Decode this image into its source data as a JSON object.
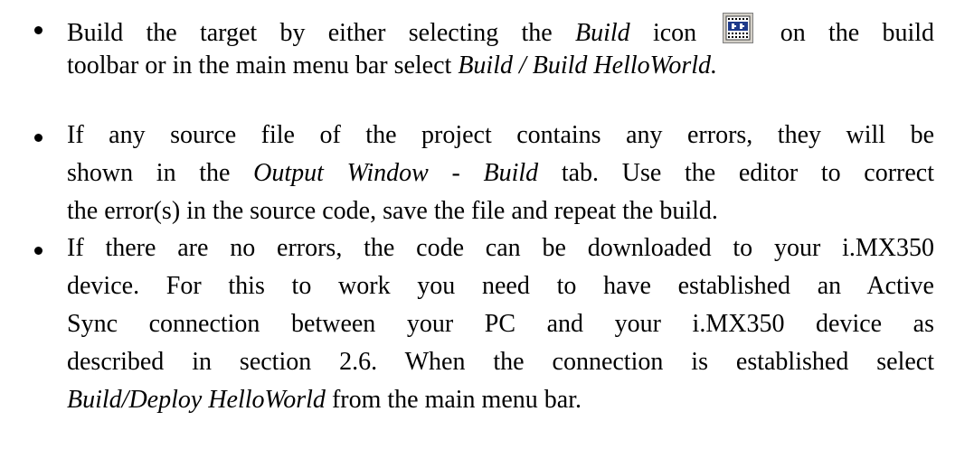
{
  "bullets": [
    {
      "lines": [
        {
          "parts": [
            {
              "text": "Build the target by either selecting the ",
              "italic": false
            },
            {
              "text": "Build",
              "italic": true
            },
            {
              "text": " icon ",
              "italic": false
            },
            {
              "icon": "build-icon"
            },
            {
              "text": " on the build",
              "italic": false
            }
          ]
        },
        {
          "parts": [
            {
              "text": "toolbar or in the main menu bar select ",
              "italic": false
            },
            {
              "text": "Build / Build HelloWorld.",
              "italic": true
            }
          ]
        }
      ]
    },
    {
      "lines": [
        {
          "parts": [
            {
              "text": "If any source file of the project contains any errors, they will be",
              "italic": false
            }
          ]
        },
        {
          "parts": [
            {
              "text": "shown in the ",
              "italic": false
            },
            {
              "text": "Output Window - Build",
              "italic": true
            },
            {
              "text": " tab. Use the editor to correct",
              "italic": false
            }
          ]
        },
        {
          "parts": [
            {
              "text": "the error(s) in the source code, save the file and repeat the build.",
              "italic": false
            }
          ]
        }
      ]
    },
    {
      "lines": [
        {
          "parts": [
            {
              "text": "If there are no errors, the code can be downloaded to your i.MX350",
              "italic": false
            }
          ]
        },
        {
          "parts": [
            {
              "text": "device. For this to work you need to have established an Active",
              "italic": false
            }
          ]
        },
        {
          "parts": [
            {
              "text": "Sync connection between your PC and your i.MX350 device as",
              "italic": false
            }
          ]
        },
        {
          "parts": [
            {
              "text": "described in section 2.6. When the connection is established select",
              "italic": false
            }
          ]
        },
        {
          "parts": [
            {
              "text": "Build/Deploy HelloWorld",
              "italic": true
            },
            {
              "text": " from the main menu bar.",
              "italic": false
            }
          ]
        }
      ]
    }
  ]
}
